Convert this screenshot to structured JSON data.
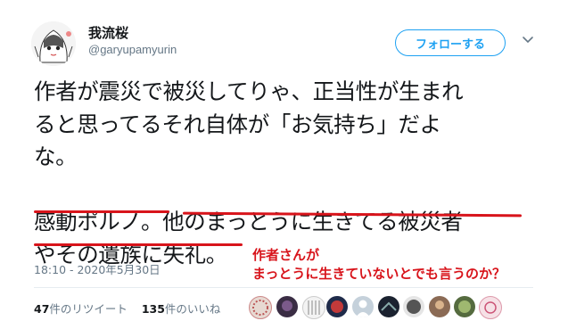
{
  "user": {
    "display_name": "我流桜",
    "handle": "@garyupamyurin",
    "avatar_icon": "anime-girl-avatar-icon"
  },
  "follow_label": "フォローする",
  "menu_icon": "chevron-down-icon",
  "tweet": {
    "line1": "作者が震災で被災してりゃ、正当性が生まれ",
    "line2": "ると思ってるそれ自体が「お気持ち」だよ",
    "line3": "な。",
    "line4": "感動ポルノ。他のまっとうに生きてる被災者",
    "line5": "やその遺族に失礼。"
  },
  "annotation": {
    "line1": "作者さんが",
    "line2": "まっとうに生きていないとでも言うのか？",
    "color": "#d8141b"
  },
  "timestamp": "18:10 - 2020年5月30日",
  "stats": {
    "retweet_count": "47",
    "retweet_label": "件のリツイート",
    "like_count": "135",
    "like_label": "件のいいね"
  },
  "accent": "#1da1f2",
  "likers": [
    "liker-avatar-1",
    "liker-avatar-2",
    "liker-avatar-3",
    "liker-avatar-4",
    "liker-avatar-5",
    "liker-avatar-6",
    "liker-avatar-7",
    "liker-avatar-8",
    "liker-avatar-9",
    "liker-avatar-10"
  ]
}
